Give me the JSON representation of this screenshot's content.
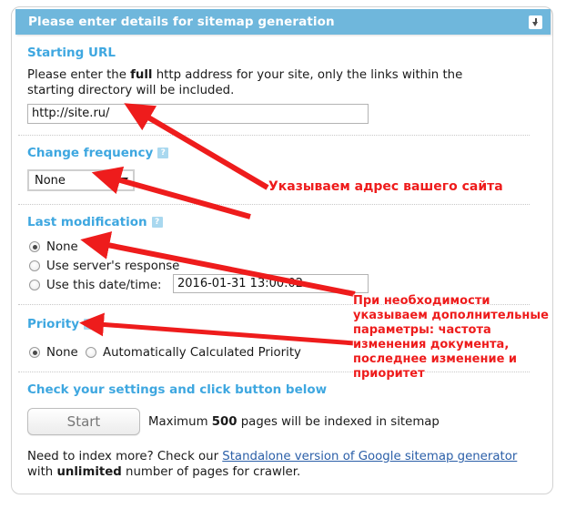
{
  "window": {
    "title": "Please enter details for sitemap generation",
    "collapse_icon": "collapse-down-icon"
  },
  "sections": {
    "starting_url": {
      "heading": "Starting URL",
      "help_icon": "?",
      "description_before": "Please enter the ",
      "description_bold": "full",
      "description_after": " http address for your site, only the links within the starting directory will be included.",
      "input_value": "http://site.ru/"
    },
    "change_frequency": {
      "heading": "Change frequency",
      "help_icon": "?",
      "selected": "None"
    },
    "last_modification": {
      "heading": "Last modification",
      "help_icon": "?",
      "options": [
        {
          "label": "None",
          "checked": true
        },
        {
          "label": "Use server's response",
          "checked": false
        },
        {
          "label": "Use this date/time:",
          "checked": false
        }
      ],
      "date_value": "2016-01-31 13:00:02"
    },
    "priority": {
      "heading": "Priority",
      "help_icon": "?",
      "options": [
        {
          "label": "None",
          "checked": true
        },
        {
          "label": "Automatically Calculated Priority",
          "checked": false
        }
      ]
    },
    "submit": {
      "heading": "Check your settings and click button below",
      "button_label": "Start",
      "note_before": "Maximum ",
      "note_bold": "500",
      "note_after": " pages will be indexed in sitemap"
    },
    "footer": {
      "line1_before": "Need to index more? Check our ",
      "link_text": "Standalone version of Google sitemap generator",
      "line2_before": "with ",
      "line2_bold": "unlimited",
      "line2_after": " number of pages for crawler."
    }
  },
  "annotations": [
    {
      "text": "Указываем адрес вашего сайта"
    },
    {
      "text": "При необходимости"
    },
    {
      "text": "указываем дополнительные"
    },
    {
      "text": "параметры: частота"
    },
    {
      "text": "изменения документа,"
    },
    {
      "text": "последнее изменение и"
    },
    {
      "text": "приоритет"
    }
  ],
  "colors": {
    "titlebar": "#6fb7dc",
    "heading": "#3ea7e0",
    "annotation": "#ee1c1c",
    "link": "#2b5fa8"
  }
}
